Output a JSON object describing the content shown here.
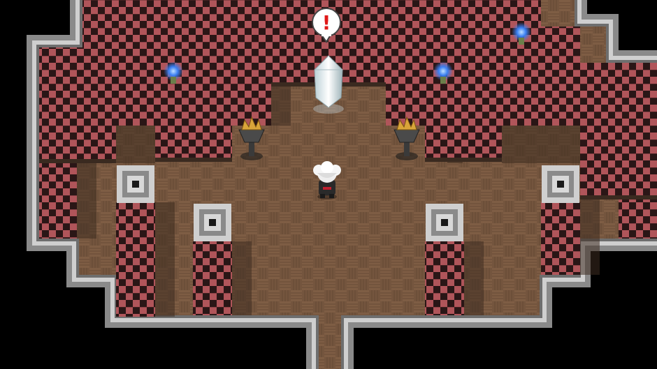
{
  "scene": {
    "name": "dungeon-crystal-chamber",
    "emote_symbol": "!"
  },
  "colors": {
    "void": "#000000",
    "wall_border": "#8a8a8a",
    "wall_border_light": "#c8c8c8",
    "check_red": "#b0555a",
    "check_dark": "#2a1616",
    "floor_a": "#7a5a42",
    "floor_b": "#6a4c36",
    "pillar_shadow": "#4e3a2a",
    "flame_blue": "#3a7ff2",
    "crystal": "#e8f2f6",
    "emote_red": "#e01818"
  },
  "sprites": {
    "player": "white-haired-character",
    "crystal": "glowing-crystal",
    "braziers": [
      "golden-brazier",
      "golden-brazier"
    ],
    "wall_torches": [
      "blue-flame-torch",
      "blue-flame-torch",
      "blue-flame-torch"
    ],
    "pressure_plates": [
      "stone-switch",
      "stone-switch",
      "stone-switch",
      "stone-switch"
    ]
  }
}
